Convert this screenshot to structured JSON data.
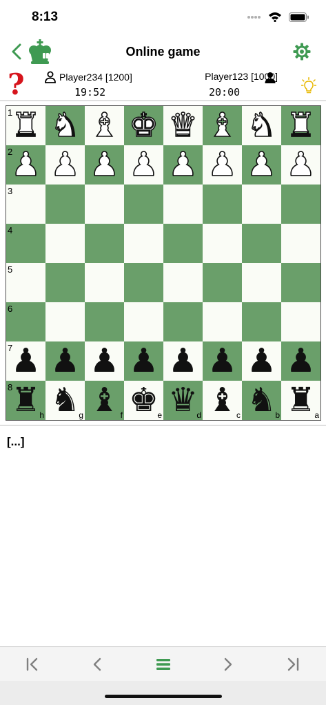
{
  "status": {
    "time": "8:13"
  },
  "header": {
    "title": "Online game"
  },
  "players": {
    "left": {
      "name": "Player234 [1200]",
      "clock": "19:52"
    },
    "right": {
      "name": "Player123 [1000]",
      "clock": "20:00"
    }
  },
  "board": {
    "rank_labels": [
      "1",
      "2",
      "3",
      "4",
      "5",
      "6",
      "7",
      "8"
    ],
    "file_labels": [
      "h",
      "g",
      "f",
      "e",
      "d",
      "c",
      "b",
      "a"
    ],
    "rows": [
      [
        "wR",
        "wN",
        "wB",
        "wK",
        "wQ",
        "wB",
        "wN",
        "wR"
      ],
      [
        "wP",
        "wP",
        "wP",
        "wP",
        "wP",
        "wP",
        "wP",
        "wP"
      ],
      [
        "",
        "",
        "",
        "",
        "",
        "",
        "",
        ""
      ],
      [
        "",
        "",
        "",
        "",
        "",
        "",
        "",
        ""
      ],
      [
        "",
        "",
        "",
        "",
        "",
        "",
        "",
        ""
      ],
      [
        "",
        "",
        "",
        "",
        "",
        "",
        "",
        ""
      ],
      [
        "bP",
        "bP",
        "bP",
        "bP",
        "bP",
        "bP",
        "bP",
        "bP"
      ],
      [
        "bR",
        "bN",
        "bB",
        "bK",
        "bQ",
        "bB",
        "bN",
        "bR"
      ]
    ],
    "colors": {
      "light": "#fafcf6",
      "dark": "#6a9f6a"
    }
  },
  "notation": {
    "text": "[...]"
  },
  "toolbar": {
    "items": [
      "first-move-icon",
      "previous-move-icon",
      "menu-icon",
      "next-move-icon",
      "last-move-icon"
    ],
    "accent": "#3f9a52"
  },
  "icons": {
    "back": "chevron-left-icon",
    "logo": "chess-king-logo-icon",
    "settings": "gear-icon",
    "help": "question-mark-icon",
    "hint": "lightbulb-icon"
  }
}
